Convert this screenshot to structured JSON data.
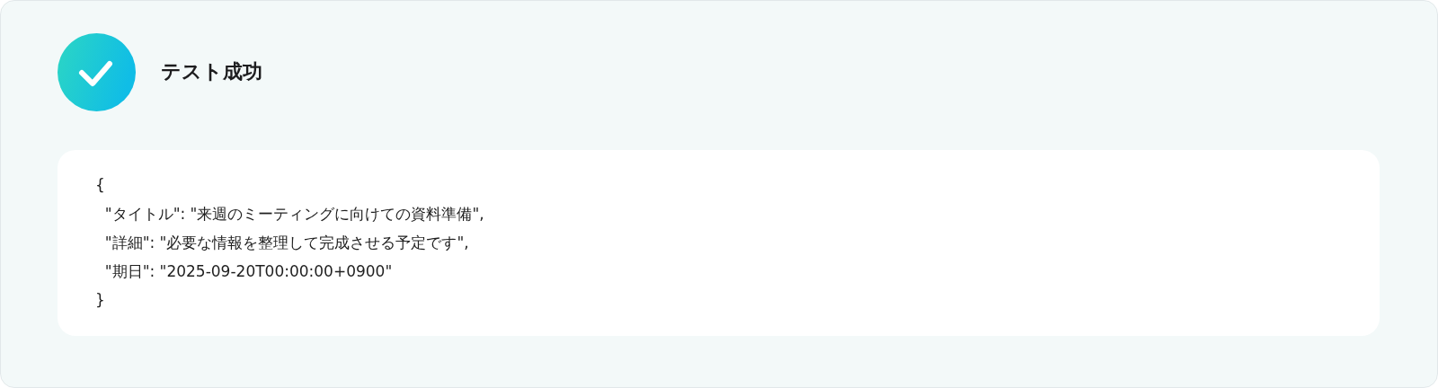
{
  "status": {
    "title": "テスト成功"
  },
  "output_lines": [
    "{",
    "  \"タイトル\": \"来週のミーティングに向けての資料準備\",",
    "  \"詳細\": \"必要な情報を整理して完成させる予定です\",",
    "  \"期日\": \"2025-09-20T00:00:00+0900\"",
    "}"
  ]
}
